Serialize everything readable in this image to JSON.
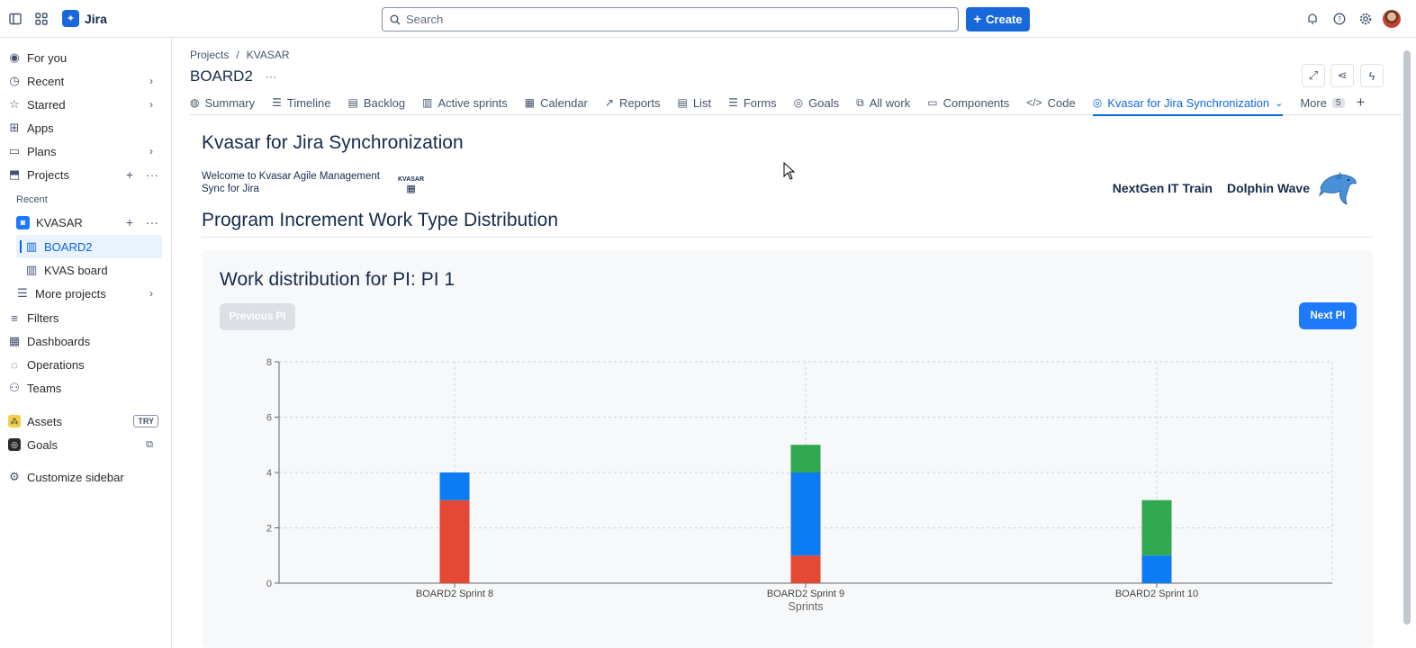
{
  "topbar": {
    "app_name": "Jira",
    "search_placeholder": "Search",
    "create_label": "Create"
  },
  "sidebar": {
    "for_you": "For you",
    "recent": "Recent",
    "starred": "Starred",
    "apps": "Apps",
    "plans": "Plans",
    "projects": "Projects",
    "recent_section": "Recent",
    "project_kvasar": "KVASAR",
    "board2": "BOARD2",
    "kvas_board": "KVAS board",
    "more_projects": "More projects",
    "filters": "Filters",
    "dashboards": "Dashboards",
    "operations": "Operations",
    "teams": "Teams",
    "assets": "Assets",
    "assets_badge": "TRY",
    "goals": "Goals",
    "customize": "Customize sidebar"
  },
  "breadcrumb": {
    "projects": "Projects",
    "separator": "/",
    "project": "KVASAR"
  },
  "page_title": "BOARD2",
  "page_title_more": "···",
  "tabs": [
    {
      "label": "Summary",
      "icon": "globe-icon",
      "glyph": "◍"
    },
    {
      "label": "Timeline",
      "icon": "timeline-icon",
      "glyph": "☰"
    },
    {
      "label": "Backlog",
      "icon": "backlog-icon",
      "glyph": "▤"
    },
    {
      "label": "Active sprints",
      "icon": "board-icon",
      "glyph": "▥"
    },
    {
      "label": "Calendar",
      "icon": "calendar-icon",
      "glyph": "▦"
    },
    {
      "label": "Reports",
      "icon": "reports-icon",
      "glyph": "↗"
    },
    {
      "label": "List",
      "icon": "list-icon",
      "glyph": "▤"
    },
    {
      "label": "Forms",
      "icon": "forms-icon",
      "glyph": "☰"
    },
    {
      "label": "Goals",
      "icon": "goals-icon",
      "glyph": "◎"
    },
    {
      "label": "All work",
      "icon": "allwork-icon",
      "glyph": "⧉"
    },
    {
      "label": "Components",
      "icon": "components-icon",
      "glyph": "▭"
    },
    {
      "label": "Code",
      "icon": "code-icon",
      "glyph": "</>"
    },
    {
      "label": "Kvasar for Jira Synchronization",
      "icon": "app-icon",
      "glyph": "◎",
      "active": true
    },
    {
      "label": "More",
      "icon": "more-icon",
      "glyph": "",
      "count": "5"
    }
  ],
  "app": {
    "title": "Kvasar for Jira Synchronization",
    "welcome": "Welcome to Kvasar Agile Management Sync for Jira",
    "kvasar_logo_text": "KVASAR",
    "brand1": "NextGen IT Train",
    "brand2": "Dolphin Wave",
    "section_title": "Program Increment Work Type Distribution",
    "pi_title": "Work distribution for PI: PI 1",
    "prev_button": "Previous PI",
    "next_button": "Next PI"
  },
  "colors": {
    "red": "#e34935",
    "blue": "#0c7cf5",
    "green": "#2fa84f",
    "accent": "#1868db"
  },
  "chart_data": {
    "type": "bar",
    "stacked": true,
    "categories": [
      "BOARD2 Sprint 8",
      "BOARD2 Sprint 9",
      "BOARD2 Sprint 10"
    ],
    "series": [
      {
        "color": "#e34935",
        "values": [
          3,
          1,
          0
        ]
      },
      {
        "color": "#0c7cf5",
        "values": [
          1,
          3,
          1
        ]
      },
      {
        "color": "#2fa84f",
        "values": [
          0,
          1,
          2
        ]
      }
    ],
    "xlabel": "Sprints",
    "ylabel": "",
    "ylim": [
      0,
      8
    ],
    "yticks": [
      0,
      2,
      4,
      6,
      8
    ],
    "grid": true
  }
}
